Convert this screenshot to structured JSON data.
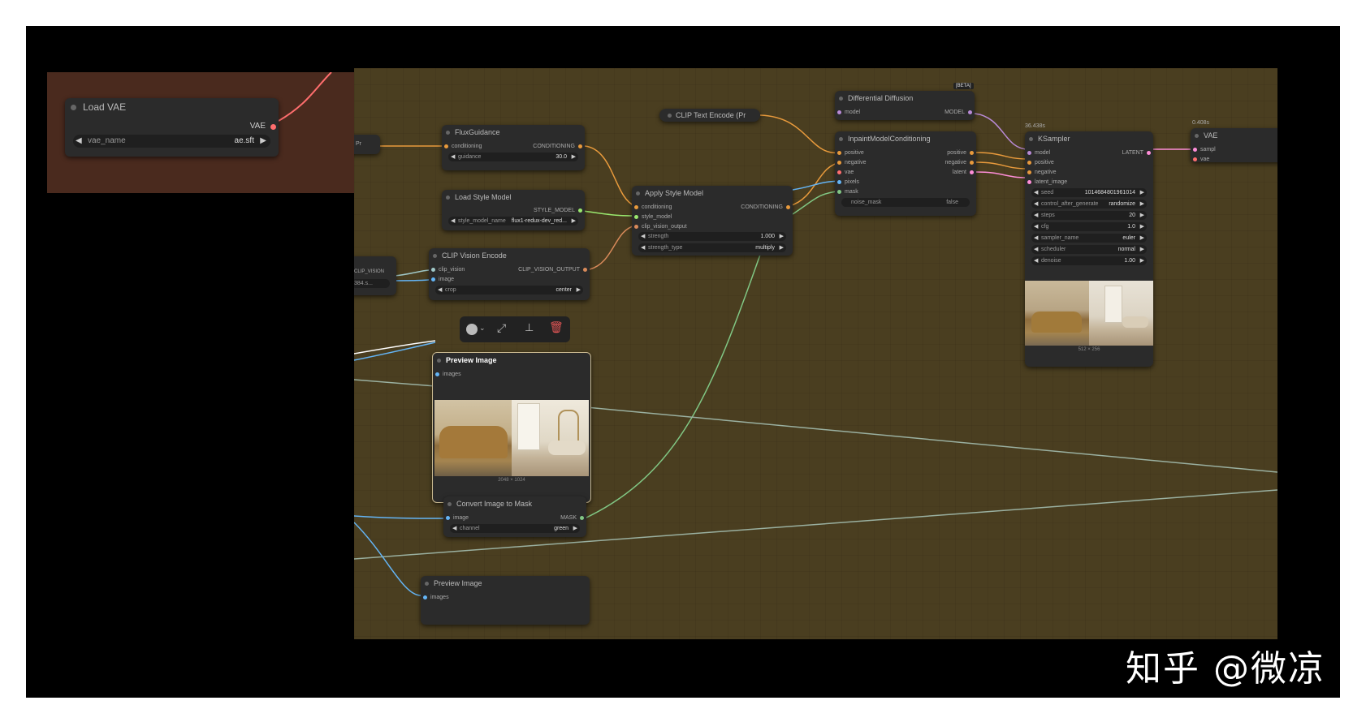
{
  "load_vae": {
    "title": "Load VAE",
    "output": "VAE",
    "widget_label": "vae_name",
    "widget_value": "ae.sft"
  },
  "flux_guidance": {
    "title": "FluxGuidance",
    "in": "conditioning",
    "out": "CONDITIONING",
    "w_label": "guidance",
    "w_value": "30.0"
  },
  "load_style": {
    "title": "Load Style Model",
    "out": "STYLE_MODEL",
    "w_label": "style_model_name",
    "w_value": "flux1-redux-dev_red..."
  },
  "clip_vision_encode": {
    "title": "CLIP Vision Encode",
    "in1": "clip_vision",
    "in2": "image",
    "out": "CLIP_VISION_OUTPUT",
    "w_label": "crop",
    "w_value": "center"
  },
  "apply_style": {
    "title": "Apply Style Model",
    "in1": "conditioning",
    "in2": "style_model",
    "in3": "clip_vision_output",
    "out": "CONDITIONING",
    "w1_label": "strength",
    "w1_value": "1.000",
    "w2_label": "strength_type",
    "w2_value": "multiply"
  },
  "clip_text": {
    "title": "CLIP Text Encode (Pr"
  },
  "diff_diffusion": {
    "badge": "[BETA]",
    "title": "Differential Diffusion",
    "in": "model",
    "out": "MODEL"
  },
  "inpaint": {
    "title": "InpaintModelConditioning",
    "in": [
      "positive",
      "negative",
      "vae",
      "pixels",
      "mask"
    ],
    "out": [
      "positive",
      "negative",
      "latent"
    ],
    "w_label": "noise_mask",
    "w_value": "false"
  },
  "ksampler": {
    "time": "36.438s",
    "title": "KSampler",
    "in": [
      "model",
      "positive",
      "negative",
      "latent_image"
    ],
    "out": "LATENT",
    "widgets": [
      {
        "label": "seed",
        "value": "1014684801961014"
      },
      {
        "label": "control_after_generate",
        "value": "randomize"
      },
      {
        "label": "steps",
        "value": "20"
      },
      {
        "label": "cfg",
        "value": "1.0"
      },
      {
        "label": "sampler_name",
        "value": "euler"
      },
      {
        "label": "scheduler",
        "value": "normal"
      },
      {
        "label": "denoise",
        "value": "1.00"
      }
    ],
    "img_size": "512 × 256"
  },
  "vae_decode": {
    "time": "0.408s",
    "title": "VAE",
    "in1": "sampl",
    "in2": "vae"
  },
  "preview1": {
    "title": "Preview Image",
    "in": "images",
    "img_size": "2048 × 1024"
  },
  "convert_mask": {
    "title": "Convert Image to Mask",
    "in": "image",
    "out": "MASK",
    "w_label": "channel",
    "w_value": "green"
  },
  "preview2": {
    "title": "Preview Image",
    "in": "images"
  },
  "left_partial": {
    "text1": "Pr",
    "text2": "CLIP_VISION",
    "text3": "384.s..."
  },
  "watermark": "知乎 @微凉",
  "colors": {
    "conditioning": "#e89a3c",
    "model": "#b98ad6",
    "vae": "#ff6e6e",
    "latent": "#ff8ed8",
    "style": "#9ae86e",
    "image": "#64b5f6",
    "mask": "#81c784"
  }
}
